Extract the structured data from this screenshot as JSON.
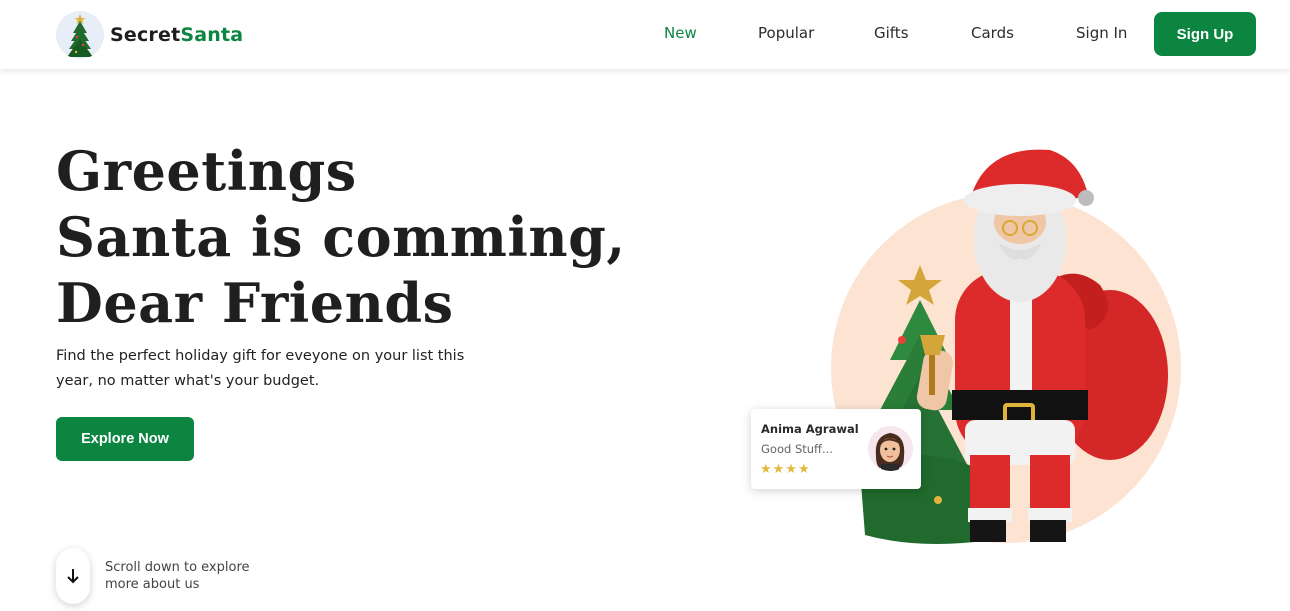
{
  "brand": {
    "name_part1": "Secret",
    "name_part2": "Santa",
    "accent": "#0c8541"
  },
  "nav": {
    "items": [
      {
        "label": "New",
        "active": true
      },
      {
        "label": "Popular"
      },
      {
        "label": "Gifts"
      },
      {
        "label": "Cards"
      },
      {
        "label": "Sign In"
      }
    ],
    "signup_label": "Sign Up"
  },
  "hero": {
    "title_lines": [
      "Greetings",
      "Santa is comming,",
      "Dear Friends"
    ],
    "subtitle": "Find the perfect holiday gift for eveyone on your list this year, no matter what's your budget.",
    "cta_label": "Explore Now"
  },
  "scroll": {
    "icon": "arrow-down-icon",
    "text": "Scroll down to explore more about us"
  },
  "review": {
    "name": "Anima Agrawal",
    "text": "Good Stuff...",
    "stars": "★★★★",
    "rating": 4
  },
  "colors": {
    "primary": "#0c8541",
    "peach": "#fde4d2",
    "star": "#e4b83c",
    "santa_red": "#dd2a2a"
  }
}
